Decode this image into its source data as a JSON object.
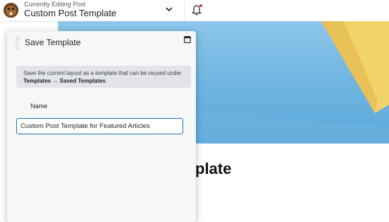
{
  "header": {
    "editing_label": "Currently Editing Post",
    "post_title": "Custom Post Template",
    "notification_color": "#d63638"
  },
  "canvas": {
    "heading_fragment": "plate"
  },
  "save_template_modal": {
    "title": "Save Template",
    "notice_prefix": "Save the current layout as a template that can be reused under ",
    "notice_path": "Templates → Saved Templates",
    "notice_suffix": ".",
    "name_label": "Name",
    "name_value": "Custom Post Template for Featured Articles"
  },
  "colors": {
    "accent": "#2271b1",
    "hero_sky": "#73b7e2",
    "hero_object": "#f2d36b"
  },
  "icons": [
    "beaver-logo-icon",
    "chevron-down-icon",
    "bell-icon",
    "drag-handle-icon",
    "maximize-icon"
  ]
}
